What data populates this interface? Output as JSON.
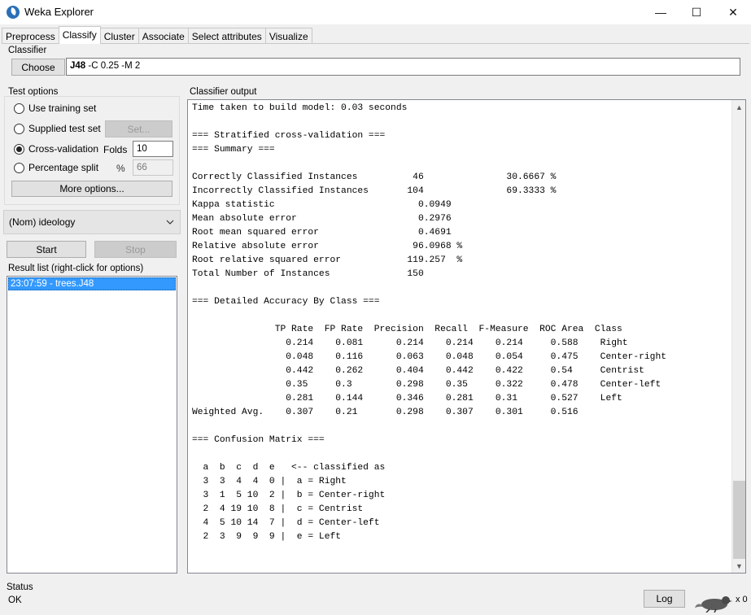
{
  "window": {
    "title": "Weka Explorer",
    "controls": {
      "minimize": "—",
      "maximize": "☐",
      "close": "✕"
    }
  },
  "tabs": [
    "Preprocess",
    "Classify",
    "Cluster",
    "Associate",
    "Select attributes",
    "Visualize"
  ],
  "active_tab": "Classify",
  "classifier": {
    "group_label": "Classifier",
    "choose_label": "Choose",
    "name": "J48",
    "options": " -C 0.25 -M 2"
  },
  "test_options": {
    "group_label": "Test options",
    "use_training_set": "Use training set",
    "supplied_test_set": "Supplied test set",
    "set_button": "Set...",
    "cross_validation": "Cross-validation",
    "folds_label": "Folds",
    "folds_value": "10",
    "percentage_split": "Percentage split",
    "percent_symbol": "%",
    "percent_value": "66",
    "selected": "cross_validation",
    "more_options": "More options..."
  },
  "class_attribute": {
    "value": "(Nom) ideology"
  },
  "actions": {
    "start": "Start",
    "stop": "Stop"
  },
  "result_list": {
    "label": "Result list (right-click for options)",
    "items": [
      "23:07:59 - trees.J48"
    ]
  },
  "output": {
    "label": "Classifier output",
    "lines": [
      "Time taken to build model: 0.03 seconds",
      "",
      "=== Stratified cross-validation ===",
      "=== Summary ===",
      "",
      "Correctly Classified Instances          46               30.6667 %",
      "Incorrectly Classified Instances       104               69.3333 %",
      "Kappa statistic                          0.0949",
      "Mean absolute error                      0.2976",
      "Root mean squared error                  0.4691",
      "Relative absolute error                 96.0968 %",
      "Root relative squared error            119.257  %",
      "Total Number of Instances              150     ",
      "",
      "=== Detailed Accuracy By Class ===",
      "",
      "               TP Rate  FP Rate  Precision  Recall  F-Measure  ROC Area  Class",
      "                 0.214    0.081      0.214    0.214    0.214     0.588    Right",
      "                 0.048    0.116      0.063    0.048    0.054     0.475    Center-right",
      "                 0.442    0.262      0.404    0.442    0.422     0.54     Centrist",
      "                 0.35     0.3        0.298    0.35     0.322     0.478    Center-left",
      "                 0.281    0.144      0.346    0.281    0.31      0.527    Left",
      "Weighted Avg.    0.307    0.21       0.298    0.307    0.301     0.516",
      "",
      "=== Confusion Matrix ===",
      "",
      "  a  b  c  d  e   <-- classified as",
      "  3  3  4  4  0 |  a = Right",
      "  3  1  5 10  2 |  b = Center-right",
      "  2  4 19 10  8 |  c = Centrist",
      "  4  5 10 14  7 |  d = Center-left",
      "  2  3  9  9  9 |  e = Left"
    ]
  },
  "status": {
    "label": "Status",
    "message": "OK",
    "log_button": "Log",
    "task_count": "x 0"
  }
}
